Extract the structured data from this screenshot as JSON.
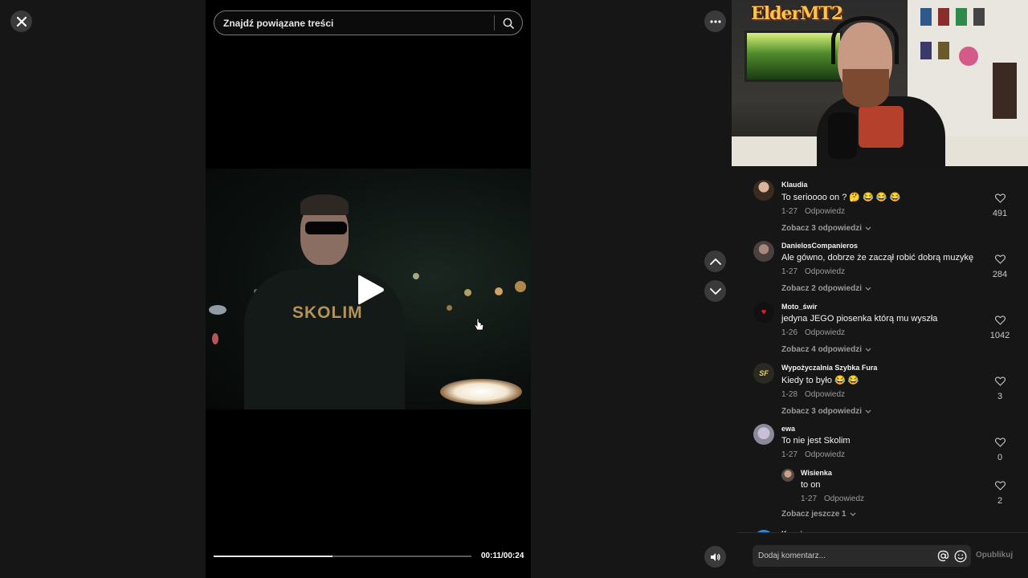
{
  "search": {
    "placeholder": "Znajdź powiązane treści"
  },
  "player": {
    "time": "00:11/00:24",
    "progress": 0.46,
    "hoodie_text": "SKOLIM"
  },
  "icons": {
    "close": "close-icon",
    "search": "search-icon",
    "more": "more-dots-icon",
    "up": "chevron-up-icon",
    "down": "chevron-down-icon",
    "volume": "volume-icon",
    "play": "play-icon",
    "heart": "heart-icon",
    "mention": "at-icon",
    "emoji": "emoji-icon"
  },
  "webcam": {
    "logo": "ElderMT2"
  },
  "comments": [
    {
      "user": "Klaudia",
      "text": "To serioooo on ? 🤔 😂 😂 😂",
      "date": "1-27",
      "reply": "Odpowiedz",
      "likes": "491",
      "more": "Zobacz 3 odpowiedzi"
    },
    {
      "user": "DanielosCompanieros",
      "text": "Ale gówno, dobrze że zaczął robić dobrą muzykę",
      "date": "1-27",
      "reply": "Odpowiedz",
      "likes": "284",
      "more": "Zobacz 2 odpowiedzi"
    },
    {
      "user": "Moto_świr",
      "text": "jedyna JEGO piosenka którą mu wyszła",
      "date": "1-26",
      "reply": "Odpowiedz",
      "likes": "1042",
      "more": "Zobacz 4 odpowiedzi"
    },
    {
      "user": "Wypożyczalnia Szybka Fura",
      "text": "Kiedy to było 😂 😂",
      "date": "1-28",
      "reply": "Odpowiedz",
      "likes": "3",
      "more": "Zobacz 3 odpowiedzi"
    },
    {
      "user": "ewa",
      "text": "To nie jest Skolim",
      "date": "1-27",
      "reply": "Odpowiedz",
      "likes": "0",
      "sub": {
        "user": "Wisienka",
        "text": "to on",
        "date": "1-27",
        "reply": "Odpowiedz",
        "likes": "2"
      },
      "more": "Zobacz jeszcze 1"
    },
    {
      "user": "Ksawi"
    }
  ],
  "composer": {
    "placeholder": "Dodaj komentarz...",
    "publish": "Opublikuj"
  }
}
